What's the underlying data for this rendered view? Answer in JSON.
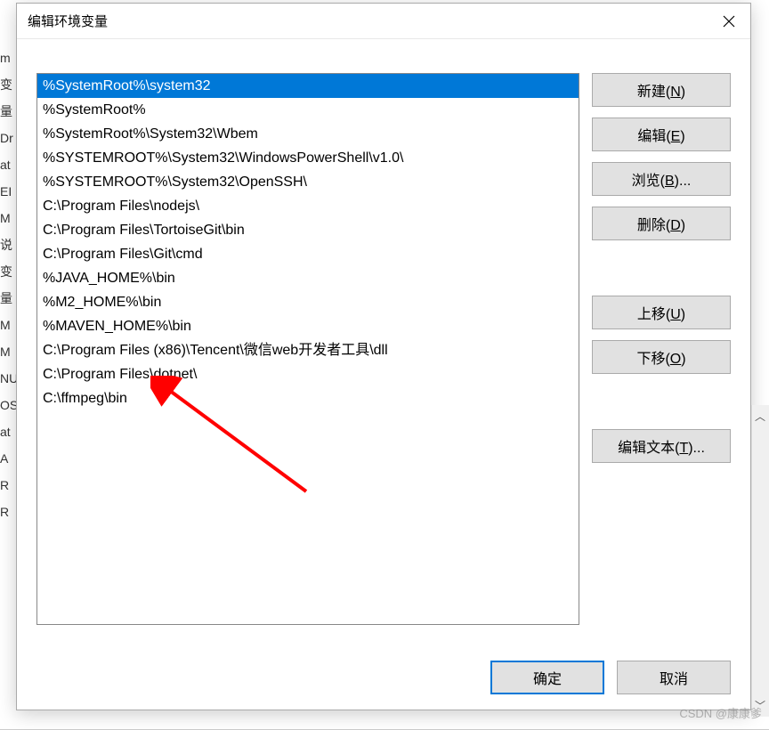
{
  "dialog": {
    "title": "编辑环境变量"
  },
  "list": {
    "items": [
      "%SystemRoot%\\system32",
      "%SystemRoot%",
      "%SystemRoot%\\System32\\Wbem",
      "%SYSTEMROOT%\\System32\\WindowsPowerShell\\v1.0\\",
      "%SYSTEMROOT%\\System32\\OpenSSH\\",
      "C:\\Program Files\\nodejs\\",
      "C:\\Program Files\\TortoiseGit\\bin",
      "C:\\Program Files\\Git\\cmd",
      "%JAVA_HOME%\\bin",
      "%M2_HOME%\\bin",
      "%MAVEN_HOME%\\bin",
      "C:\\Program Files (x86)\\Tencent\\微信web开发者工具\\dll",
      "C:\\Program Files\\dotnet\\",
      "C:\\ffmpeg\\bin"
    ],
    "selected_index": 0
  },
  "buttons": {
    "new": {
      "text": "新建",
      "mnemonic": "N"
    },
    "edit": {
      "text": "编辑",
      "mnemonic": "E"
    },
    "browse": {
      "text": "浏览",
      "mnemonic": "B",
      "suffix": "..."
    },
    "delete": {
      "text": "删除",
      "mnemonic": "D"
    },
    "moveup": {
      "text": "上移",
      "mnemonic": "U"
    },
    "movedn": {
      "text": "下移",
      "mnemonic": "O"
    },
    "edittext": {
      "text": "编辑文本",
      "mnemonic": "T",
      "suffix": "..."
    },
    "ok": "确定",
    "cancel": "取消"
  },
  "bg_fragments": [
    "m",
    "变量",
    "Dr",
    "at",
    "EI",
    "M",
    "说",
    "变量",
    "M",
    "M",
    "NU",
    "OS",
    "at",
    "A",
    "R",
    "R"
  ],
  "watermark": "CSDN @康康爹"
}
